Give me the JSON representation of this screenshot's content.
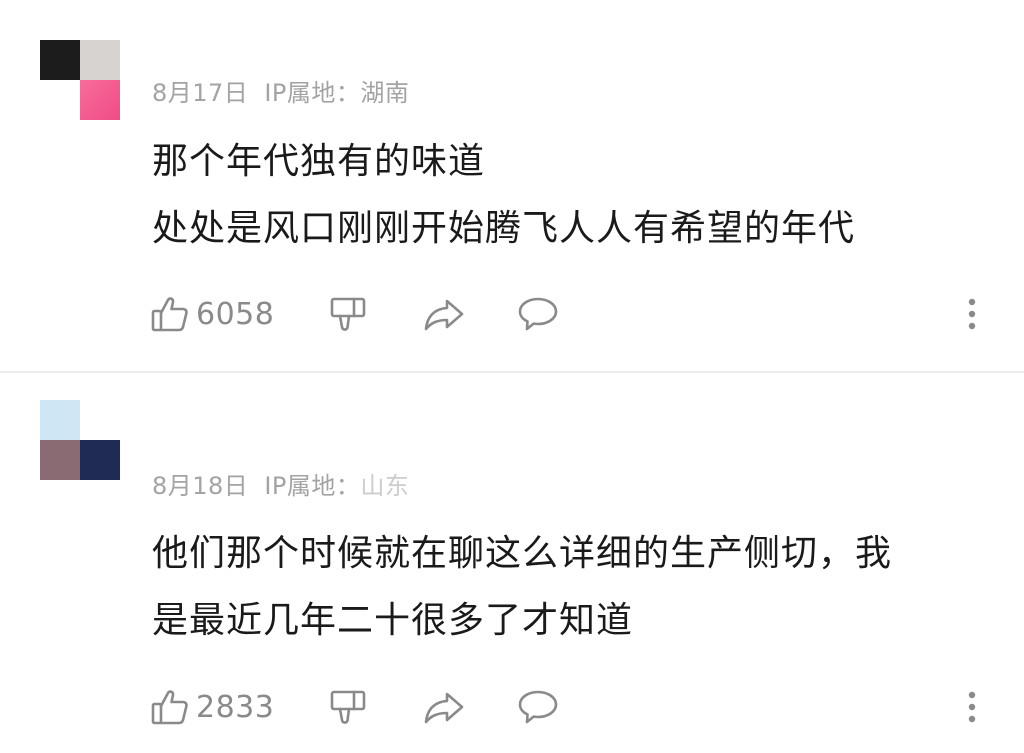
{
  "comments": [
    {
      "avatar": {
        "colors": [
          "#1c1c1c",
          "#d6d3d0",
          "#ffffff",
          "#f2548a"
        ]
      },
      "date": "8月17日",
      "ip_label": "IP属地：",
      "ip_location": "湖南",
      "lines": [
        "那个年代独有的味道",
        "处处是风口刚刚开始腾飞人人有希望的年代"
      ],
      "like_count": "6058"
    },
    {
      "avatar": {
        "colors": [
          "#cfe6f5",
          "#ffffff",
          "#8a6b73",
          "#1f2a55"
        ]
      },
      "date": "8月18日",
      "ip_label": "IP属地：",
      "ip_location": "山东",
      "lines": [
        "他们那个时候就在聊这么详细的生产侧切，我",
        "是最近几年二十很多了才知道"
      ],
      "like_count": "2833"
    }
  ],
  "icons": {
    "like": "thumbs-up-icon",
    "dislike": "thumbs-down-icon",
    "share": "share-arrow-icon",
    "reply": "comment-bubble-icon",
    "more": "more-vertical-icon"
  }
}
